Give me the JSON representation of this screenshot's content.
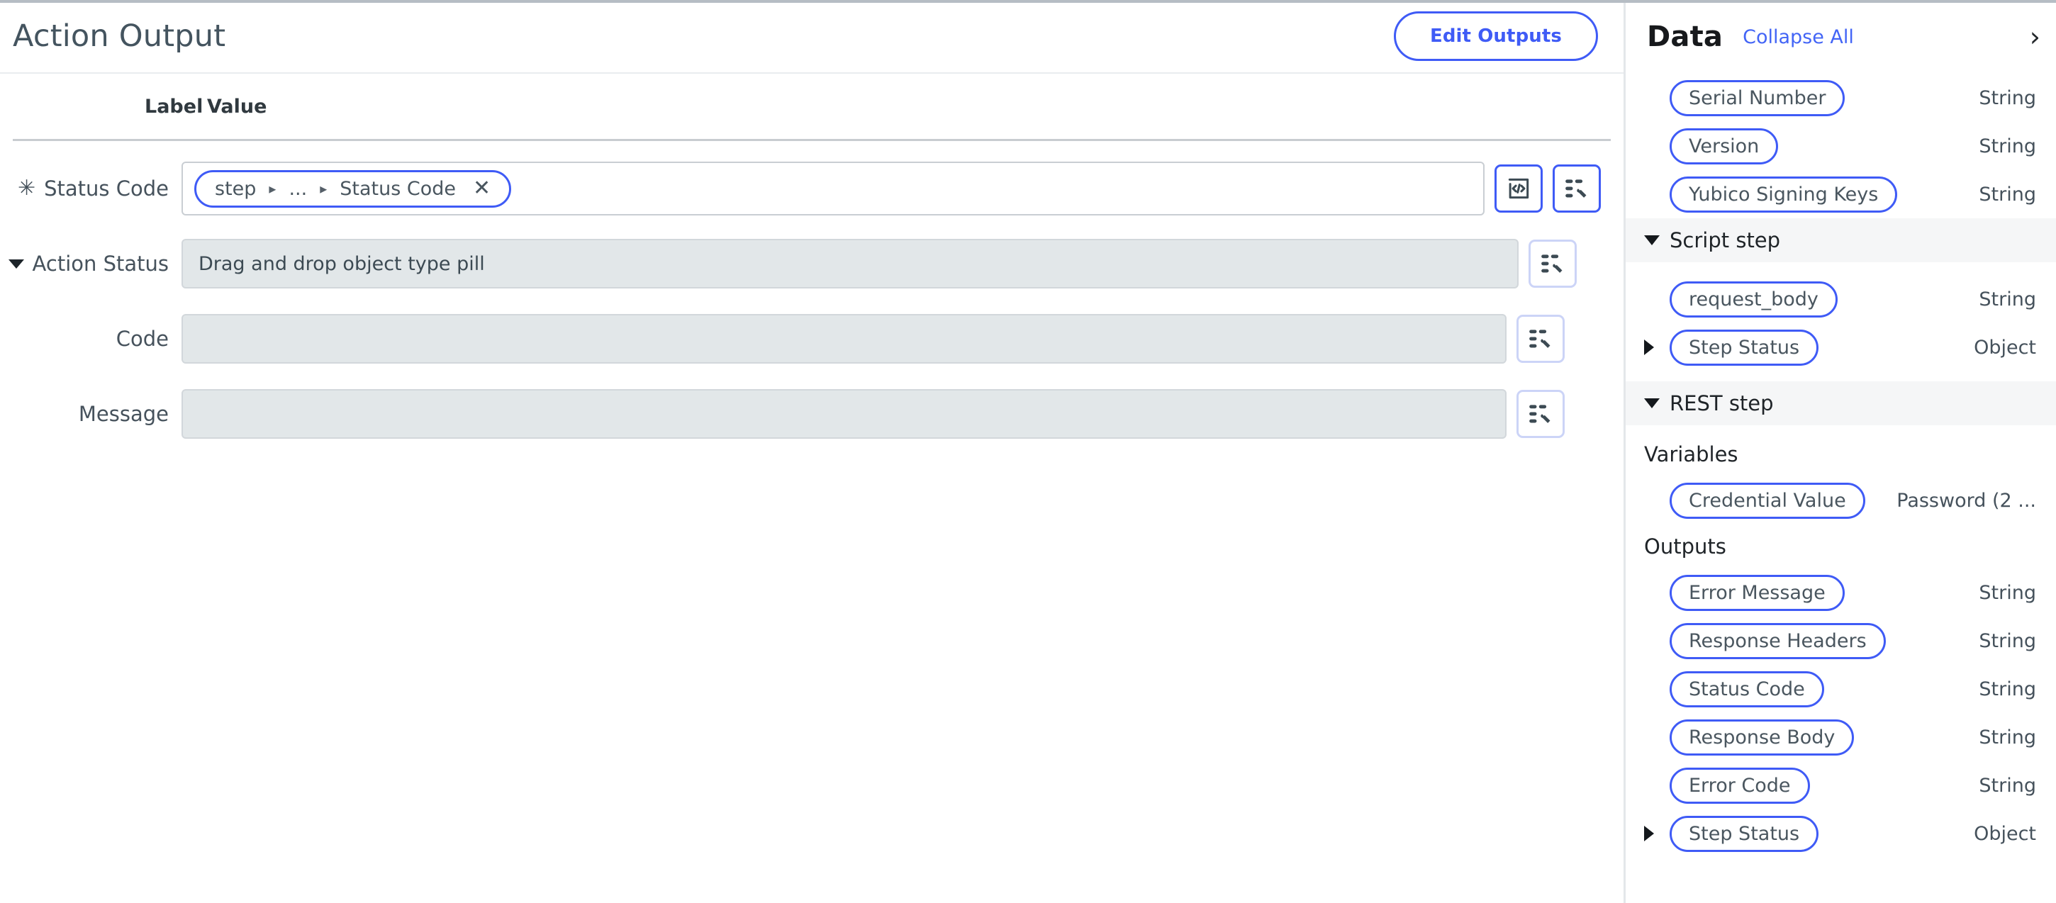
{
  "window": {
    "divider_color": "#b6bdc4"
  },
  "main": {
    "title": "Action Output",
    "edit_outputs_label": "Edit Outputs",
    "columns": {
      "label": "Label",
      "value": "Value"
    },
    "rows": [
      {
        "label": "Status Code",
        "required_marker": "✳",
        "kind": "token",
        "token": {
          "parts": [
            "step",
            "...",
            "Status Code"
          ],
          "separator": "▸",
          "remove_label": "✕"
        },
        "buttons": [
          "code-brackets-icon",
          "magic-wand-list-icon"
        ]
      },
      {
        "label": "Action Status",
        "kind": "expandable",
        "expanded": true,
        "value": "Drag and drop object type pill",
        "buttons": [
          "magic-wand-list-icon"
        ]
      },
      {
        "label": "Code",
        "kind": "sub",
        "value": "",
        "buttons": [
          "magic-wand-list-icon"
        ]
      },
      {
        "label": "Message",
        "kind": "sub",
        "value": "",
        "buttons": [
          "magic-wand-list-icon"
        ]
      }
    ]
  },
  "sidebar": {
    "title": "Data",
    "collapse_all": "Collapse All",
    "expand_chevron": "›",
    "top_items": [
      {
        "name": "Serial Number",
        "type": "String",
        "expandable": false
      },
      {
        "name": "Version",
        "type": "String",
        "expandable": false
      },
      {
        "name": "Yubico Signing Keys",
        "type": "String",
        "expandable": false
      }
    ],
    "sections": [
      {
        "title": "Script step",
        "expanded": true,
        "groups": [
          {
            "label": null,
            "items": [
              {
                "name": "request_body",
                "type": "String",
                "expandable": false
              },
              {
                "name": "Step Status",
                "type": "Object",
                "expandable": true
              }
            ]
          }
        ]
      },
      {
        "title": "REST step",
        "expanded": true,
        "groups": [
          {
            "label": "Variables",
            "items": [
              {
                "name": "Credential Value",
                "type": "Password (2 ...",
                "expandable": false
              }
            ]
          },
          {
            "label": "Outputs",
            "items": [
              {
                "name": "Error Message",
                "type": "String",
                "expandable": false
              },
              {
                "name": "Response Headers",
                "type": "String",
                "expandable": false
              },
              {
                "name": "Status Code",
                "type": "String",
                "expandable": false
              },
              {
                "name": "Response Body",
                "type": "String",
                "expandable": false
              },
              {
                "name": "Error Code",
                "type": "String",
                "expandable": false
              },
              {
                "name": "Step Status",
                "type": "Object",
                "expandable": true
              }
            ]
          }
        ]
      }
    ]
  },
  "colors": {
    "accent_blue": "#3f5bf6",
    "link_blue": "#4365f6",
    "text": "#46525c",
    "disabled_field_bg": "#e2e7e9",
    "section_bg": "#f5f6f7"
  }
}
